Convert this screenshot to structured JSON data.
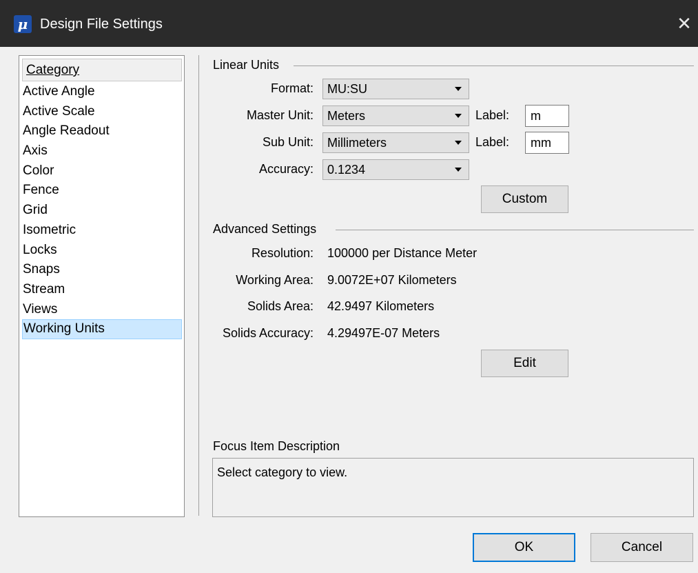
{
  "window": {
    "title": "Design File Settings",
    "icon": "microstation-mu-icon",
    "close_glyph": "✕"
  },
  "category": {
    "header": "Category",
    "items": [
      "Active Angle",
      "Active Scale",
      "Angle Readout",
      "Axis",
      "Color",
      "Fence",
      "Grid",
      "Isometric",
      "Locks",
      "Snaps",
      "Stream",
      "Views",
      "Working Units"
    ],
    "selected": "Working Units"
  },
  "linear_units": {
    "group_label": "Linear Units",
    "format": {
      "label": "Format:",
      "value": "MU:SU"
    },
    "master_unit": {
      "label": "Master Unit:",
      "value": "Meters",
      "label_text": "Label:",
      "label_value": "m"
    },
    "sub_unit": {
      "label": "Sub Unit:",
      "value": "Millimeters",
      "label_text": "Label:",
      "label_value": "mm"
    },
    "accuracy": {
      "label": "Accuracy:",
      "value": "0.1234"
    },
    "custom_button": "Custom"
  },
  "advanced_settings": {
    "group_label": "Advanced Settings",
    "resolution": {
      "label": "Resolution:",
      "value": "100000 per Distance Meter"
    },
    "working_area": {
      "label": "Working Area:",
      "value": "9.0072E+07 Kilometers"
    },
    "solids_area": {
      "label": "Solids Area:",
      "value": "42.9497 Kilometers"
    },
    "solids_accuracy": {
      "label": "Solids Accuracy:",
      "value": "4.29497E-07 Meters"
    },
    "edit_button": "Edit"
  },
  "focus_item": {
    "label": "Focus Item Description",
    "text": "Select category to view."
  },
  "footer": {
    "ok_button": "OK",
    "cancel_button": "Cancel"
  },
  "colors": {
    "titlebar": "#2b2b2b",
    "selection": "#cce8ff",
    "default_button_border": "#0078d7",
    "dialog_bg": "#f0f0f0"
  }
}
